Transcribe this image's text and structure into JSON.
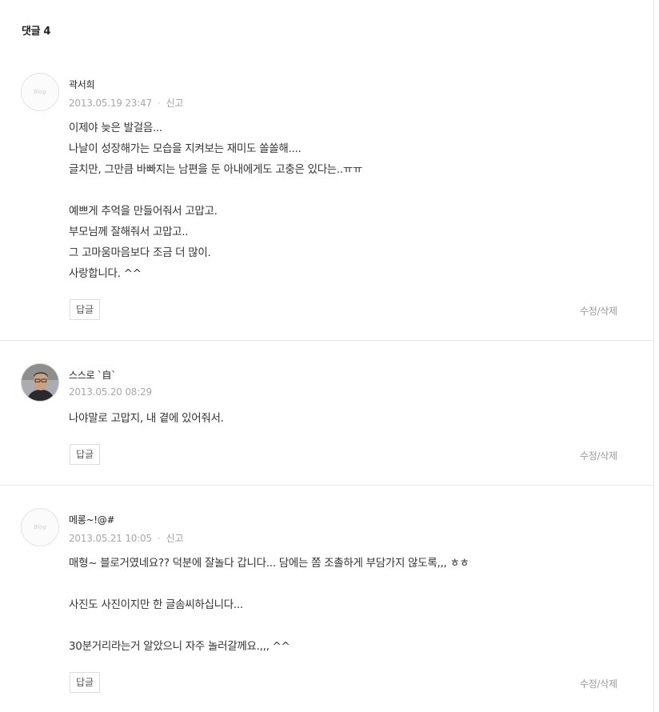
{
  "header": {
    "label": "댓글",
    "count": "4"
  },
  "comments": [
    {
      "author": "곽서희",
      "avatar": "default-avatar",
      "avatar_text": "Blog",
      "date": "2013.05.19 23:47",
      "separator": "·",
      "report": "신고",
      "lines": [
        "이제야 늦은 발걸음...",
        "나날이 성장해가는 모습을 지켜보는 재미도 쏠쏠해....",
        "글치만, 그만큼 바빠지는 남편을 둔 아내에게도 고충은 있다는..ㅠㅠ",
        "",
        "예쁘게 추억을 만들어줘서 고맙고.",
        "부모님께 잘해줘서 고맙고..",
        "그 고마움마음보다 조금 더 많이.",
        "사랑합니다. ^^"
      ],
      "reply": "답글",
      "edit": "수정/삭제"
    },
    {
      "author": "스스로 `自`",
      "avatar": "profile-photo",
      "date": "2013.05.20 08:29",
      "lines": [
        "나야말로 고맙지, 내 곁에 있어줘서."
      ],
      "reply": "답글",
      "edit": "수정/삭제"
    },
    {
      "author": "메롱~!@#",
      "avatar": "default-avatar",
      "avatar_text": "Blog",
      "date": "2013.05.21 10:05",
      "separator": "·",
      "report": "신고",
      "lines": [
        "매형~ 블로거였네요?? 덕분에 잘놀다 갑니다... 담에는 쫌 조촐하게 부담가지 않도록,,, ㅎㅎ",
        "",
        "사진도 사진이지만 한 글솜씨하십니다...",
        "",
        "30분거리라는거 알았으니 자주 놀러갈께요.,,, ^^"
      ],
      "reply": "답글",
      "edit": "수정/삭제"
    }
  ]
}
